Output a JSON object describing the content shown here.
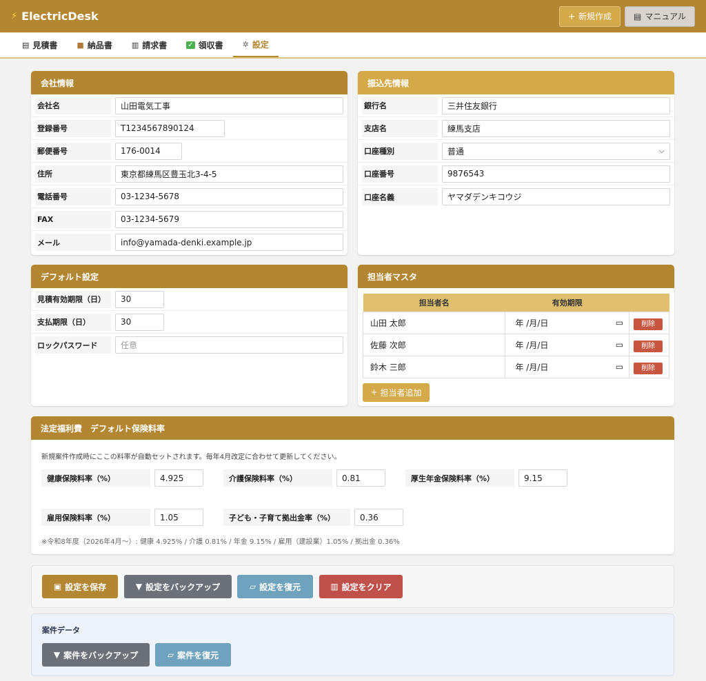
{
  "app": {
    "title": "ElectricDesk",
    "new_label": "新規作成",
    "manual_label": "マニュアル"
  },
  "tabs": [
    {
      "label": "見積書",
      "icon": "memo-icon"
    },
    {
      "label": "納品書",
      "icon": "package-icon"
    },
    {
      "label": "請求書",
      "icon": "receipt-icon"
    },
    {
      "label": "領収書",
      "icon": "check-icon"
    },
    {
      "label": "設定",
      "icon": "gear-icon"
    }
  ],
  "company": {
    "title": "会社情報",
    "fields": [
      {
        "label": "会社名",
        "value": "山田電気工事"
      },
      {
        "label": "登録番号",
        "value": "T1234567890124"
      },
      {
        "label": "郵便番号",
        "value": "176-0014"
      },
      {
        "label": "住所",
        "value": "東京都練馬区豊玉北3-4-5"
      },
      {
        "label": "電話番号",
        "value": "03-1234-5678"
      },
      {
        "label": "FAX",
        "value": "03-1234-5679"
      },
      {
        "label": "メール",
        "value": "info@yamada-denki.example.jp"
      }
    ]
  },
  "bank": {
    "title": "振込先情報",
    "fields": [
      {
        "label": "銀行名",
        "value": "三井住友銀行"
      },
      {
        "label": "支店名",
        "value": "練馬支店"
      },
      {
        "label": "口座種別",
        "value": "普通"
      },
      {
        "label": "口座番号",
        "value": "9876543"
      },
      {
        "label": "口座名義",
        "value": "ヤマダデンキコウジ"
      }
    ]
  },
  "defaults": {
    "title": "デフォルト設定",
    "fields": [
      {
        "label": "見積有効期限（日）",
        "value": "30"
      },
      {
        "label": "支払期限（日）",
        "value": "30"
      },
      {
        "label": "ロックパスワード",
        "value": "",
        "placeholder": "任意"
      }
    ]
  },
  "staff": {
    "title": "担当者マスタ",
    "columns": [
      "担当者名",
      "有効期限"
    ],
    "rows": [
      {
        "name": "山田 太郎",
        "date": "年 /月/日"
      },
      {
        "name": "佐藤 次郎",
        "date": "年 /月/日"
      },
      {
        "name": "鈴木 三郎",
        "date": "年 /月/日"
      }
    ],
    "delete_label": "削除",
    "add_label": "担当者追加"
  },
  "insurance": {
    "title": "法定福利費　デフォルト保険料率",
    "note": "新規案件作成時にここの料率が自動セットされます。毎年4月改定に合わせて更新してください。",
    "health_label": "健康保険料率（%）",
    "health_value": "4.925",
    "care_label": "介護保険料率（%）",
    "care_value": "0.81",
    "pension_label": "厚生年金保険料率（%）",
    "pension_value": "9.15",
    "employment_label": "雇用保険料率（%）",
    "employment_value": "1.05",
    "child_label": "子ども・子育て拠出金率（%）",
    "child_value": "0.36",
    "footnote": "※令和8年度（2026年4月〜）: 健康 4.925% / 介護 0.81% / 年金 9.15% / 雇用（建設業）1.05% / 拠出金 0.36%"
  },
  "actions": {
    "save_label": "設定を保存",
    "backup_label": "設定をバックアップ",
    "restore_label": "設定を復元",
    "clear_label": "設定をクリア"
  },
  "cases": {
    "title": "案件データ",
    "backup_label": "案件をバックアップ",
    "restore_label": "案件を復元"
  }
}
